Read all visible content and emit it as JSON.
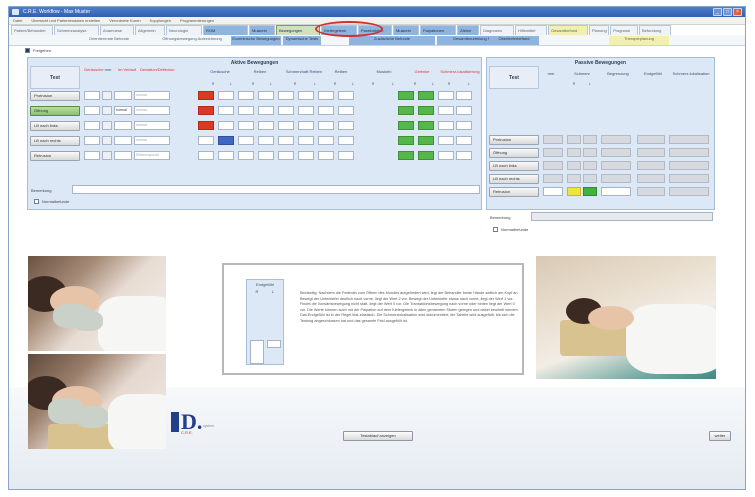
{
  "window": {
    "title": "C.R.E. Workflow - Max Muster",
    "controls": [
      "_",
      "□",
      "×"
    ]
  },
  "menu": [
    "Datei",
    "Übersicht und Patientendaten erstellen",
    "Verordnete Kuren",
    "Kopplungen",
    "Programmierungen"
  ],
  "tabs": [
    {
      "label": "Patient/Behandler",
      "style": "plain"
    },
    {
      "label": "Schmerzanalyse",
      "style": "plain"
    },
    {
      "label": "Anamnese",
      "style": "plain"
    },
    {
      "label": "Allgemein",
      "style": "plain"
    },
    {
      "label": "Neurologie",
      "style": "plain"
    },
    {
      "label": "ROM",
      "style": "blue"
    },
    {
      "label": "Muskeln",
      "style": "blue"
    },
    {
      "label": "Bewegungen",
      "style": "active"
    },
    {
      "label": "Kiefergelenk",
      "style": "blue"
    },
    {
      "label": "Parafunktion",
      "style": "blue"
    },
    {
      "label": "Muskeln",
      "style": "blue"
    },
    {
      "label": "Palpationen",
      "style": "blue"
    },
    {
      "label": "Zähne",
      "style": "blue"
    },
    {
      "label": "Diagnosen",
      "style": "plain"
    },
    {
      "label": "Hilfsmittel",
      "style": "plain"
    },
    {
      "label": "Gesamtbefund",
      "style": "yellow"
    },
    {
      "label": "Planung",
      "style": "plain"
    },
    {
      "label": "Prognose",
      "style": "plain"
    },
    {
      "label": "Befundung",
      "style": "plain"
    }
  ],
  "subtabs": [
    {
      "label": "Orientierende Befunde",
      "style": "plain"
    },
    {
      "label": "Öffnungsbewegung Aufzeichnung",
      "style": "plain"
    },
    {
      "label": "Exzentrische Bewegungen",
      "style": "blue"
    },
    {
      "label": "Dynamische Tests",
      "style": "blue"
    },
    {
      "label": "Zusätzliche Befunde",
      "style": "blue"
    },
    {
      "label": "Gesamtbeurteilung System",
      "style": "blue"
    },
    {
      "label": "Oberkieferbefund",
      "style": "blue"
    },
    {
      "label": "Therapieplanung",
      "style": "yellow"
    }
  ],
  "top_checkbox": {
    "label": "Freigeben",
    "checked": true
  },
  "active_panel": {
    "title": "Aktive Bewegungen",
    "test_header": "Test",
    "col_headers": [
      {
        "label": "Geräusche",
        "red": true
      },
      {
        "label": "mm",
        "red": false
      },
      {
        "label": "Im Verlauf",
        "red": true
      },
      {
        "label": "Deviation/Deflexion",
        "red": true
      },
      {
        "label": "Geräusche",
        "red": false
      },
      {
        "label": "Reiben",
        "red": false
      },
      {
        "label": "Schmerzhaft Reiben",
        "red": false
      },
      {
        "label": "Reiben",
        "red": false
      },
      {
        "label": "Muskeln",
        "red": false
      },
      {
        "label": "Gelenke",
        "red": true
      },
      {
        "label": "Schmerz-lokalisierung",
        "red": true
      }
    ],
    "rl_labels": [
      "R",
      "L"
    ],
    "rows": [
      {
        "label": "Protrusion",
        "active": false,
        "mm": "",
        "field1": "",
        "field2": "",
        "text": "normal",
        "colors": [
          "red",
          "",
          "",
          "",
          "",
          "",
          "",
          "",
          "green",
          "green"
        ]
      },
      {
        "label": "Öffnung",
        "active": true,
        "mm": "",
        "field1": "",
        "field2": "normal",
        "text": "normal",
        "colors": [
          "red",
          "",
          "",
          "",
          "",
          "",
          "",
          "",
          "green",
          "green"
        ]
      },
      {
        "label": "LB nach links",
        "active": false,
        "mm": "",
        "field1": "",
        "field2": "",
        "text": "normal",
        "colors": [
          "red",
          "",
          "",
          "",
          "",
          "",
          "",
          "",
          "green",
          "green"
        ]
      },
      {
        "label": "LB nach rechts",
        "active": false,
        "mm": "",
        "field1": "",
        "field2": "",
        "text": "normal",
        "colors": [
          "",
          "blue",
          "",
          "",
          "",
          "",
          "",
          "",
          "green",
          "green"
        ]
      },
      {
        "label": "Retrusion",
        "active": false,
        "mm": "",
        "field1": "",
        "field2": "",
        "text": "Referenzpunkt",
        "colors": [
          "",
          "",
          "",
          "",
          "",
          "",
          "",
          "",
          "green",
          "green"
        ]
      }
    ],
    "remark_label": "Bemerkung",
    "status_label": "Normalbefunde"
  },
  "passive_panel": {
    "title": "Passive Bewegungen",
    "test_header": "Test",
    "col_headers": [
      "mm",
      "Schmerz",
      "Begrenzung",
      "Endgefühl",
      "Schmerz-lokalisation"
    ],
    "rl_labels": [
      "R",
      "L"
    ],
    "rows": [
      {
        "label": "Protrusion",
        "active": false
      },
      {
        "label": "Öffnung",
        "active": false
      },
      {
        "label": "LB nach links",
        "active": false
      },
      {
        "label": "LB nach rechts",
        "active": false
      },
      {
        "label": "Retrusion",
        "active": false
      }
    ],
    "remark_label": "Bemerkung",
    "status_label": "Normalbefunde"
  },
  "info_box": {
    "mini_title": "Endgefühl",
    "mini_rl": [
      "R",
      "L"
    ],
    "text": "Beidseitig: Nachdem die Patientin zum Öffnen des Mundes aufgefordert wird, legt der Behandler beide Hände seitlich am Kopf an. Bewegt der Unterkiefer deutlich nach vorne, liegt der Wert 2 vor. Bewegt der Unterkiefer etwas nach vorne, liegt der Wert 1 vor. Findet die Vorwärtsbewegung nicht statt, liegt der Wert 0 vor. Die Translationsbewegung nach vorne oder hinten liegt der Wert 0 vor. Die Werte können auch mit der Palpation auf dem Kiefergelenk in allen genannten Stufen gelegen und dabei beurteilt werden. Das Endgefühl ist in der Regel fest-elastisch. Die Schmerzlokalisation wird dokumentiert, die Tabelle wird ausgefüllt, bis sich die Testung abgeschlossen hat und das gesamte Feld ausgefüllt ist."
  },
  "logo": {
    "letter": "D.",
    "tag": "C.R.E.",
    "tag2": "system"
  },
  "buttons": {
    "procedure": "Testablauf anzeigen",
    "next": "weiter"
  }
}
